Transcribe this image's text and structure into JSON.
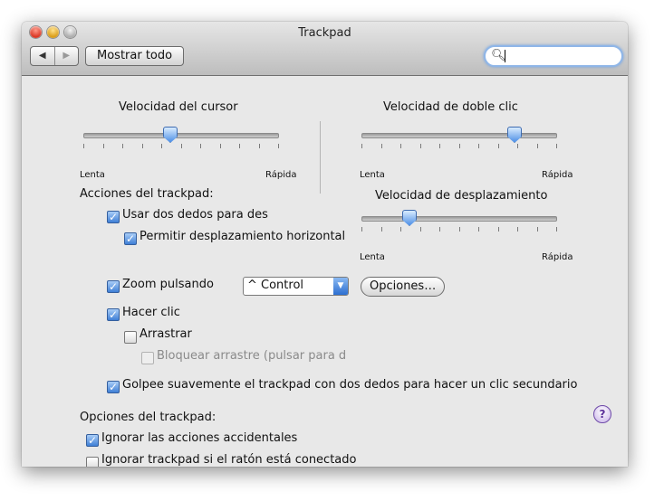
{
  "window": {
    "title": "Trackpad"
  },
  "toolbar": {
    "back_icon": "◀",
    "forward_icon": "▶",
    "show_all_label": "Mostrar todo",
    "search": {
      "value": "",
      "placeholder": "",
      "icon": "search-icon"
    }
  },
  "cursor_speed": {
    "label": "Velocidad del cursor",
    "min_label": "Lenta",
    "max_label": "Rápida",
    "value": 0.44
  },
  "double_click_speed": {
    "label": "Velocidad de doble clic",
    "min_label": "Lenta",
    "max_label": "Rápida",
    "value": 0.78
  },
  "scroll_speed": {
    "label": "Velocidad de desplazamiento",
    "min_label": "Lenta",
    "max_label": "Rápida",
    "value": 0.24
  },
  "trackpad_actions": {
    "heading": "Acciones del trackpad:",
    "two_finger_scroll": {
      "label": "Usar dos dedos para des",
      "checked": true
    },
    "horizontal_scroll": {
      "label": "Permitir desplazamiento horizontal",
      "checked": true
    },
    "zoom": {
      "label": "Zoom pulsando",
      "checked": true,
      "modifier": "^ Control"
    },
    "options_button": "Opciones…",
    "click": {
      "label": "Hacer clic",
      "checked": true
    },
    "drag": {
      "label": "Arrastrar",
      "checked": false
    },
    "drag_lock": {
      "label": "Bloquear arrastre (pulsar para d",
      "checked": false
    },
    "secondary_click": {
      "label": "Golpee suavemente el trackpad con dos dedos para hacer un clic secundario",
      "checked": true
    }
  },
  "trackpad_options": {
    "heading": "Opciones del trackpad:",
    "ignore_accidental": {
      "label": "Ignorar las acciones accidentales",
      "checked": true
    },
    "ignore_with_mouse": {
      "label": "Ignorar trackpad si el ratón está conectado",
      "checked": false
    }
  },
  "help_label": "?",
  "colors": {
    "accent": "#3f7fd6",
    "window_bg": "#e8e8e8"
  }
}
